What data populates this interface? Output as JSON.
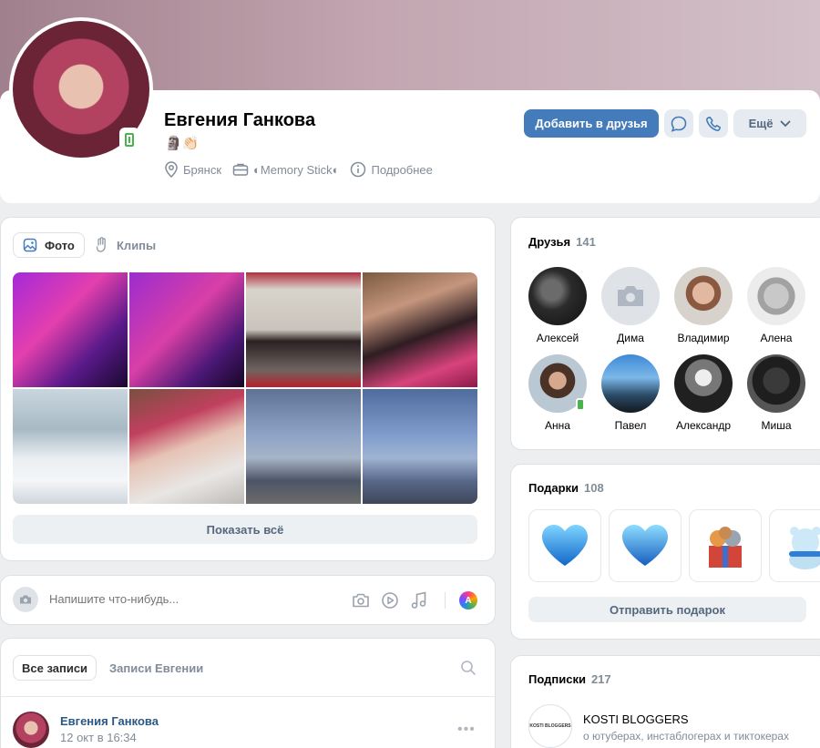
{
  "profile": {
    "name": "Евгения Ганкова",
    "status": "🗿👏🏻",
    "city": "Брянск",
    "work": "◐Memory Stick◐",
    "more_info": "Подробнее",
    "buttons": {
      "add_friend": "Добавить в друзья",
      "more": "Ещё"
    }
  },
  "media": {
    "tabs": [
      {
        "label": "Фото",
        "icon": "image-icon",
        "active": true
      },
      {
        "label": "Клипы",
        "icon": "clips-icon",
        "active": false
      }
    ],
    "show_all": "Показать всё"
  },
  "composer": {
    "placeholder": "Напишите что-нибудь..."
  },
  "wall": {
    "tabs": [
      {
        "label": "Все записи",
        "active": true
      },
      {
        "label": "Записи Евгении",
        "active": false
      }
    ],
    "post": {
      "author": "Евгения Ганкова",
      "time": "12 окт в 16:34"
    }
  },
  "friends": {
    "title": "Друзья",
    "count": "141",
    "items": [
      {
        "name": "Алексей"
      },
      {
        "name": "Дима"
      },
      {
        "name": "Владимир"
      },
      {
        "name": "Алена"
      },
      {
        "name": "Анна"
      },
      {
        "name": "Павел"
      },
      {
        "name": "Александр"
      },
      {
        "name": "Миша"
      }
    ]
  },
  "gifts": {
    "title": "Подарки",
    "count": "108",
    "send": "Отправить подарок"
  },
  "subscriptions": {
    "title": "Подписки",
    "count": "217",
    "items": [
      {
        "name": "KOSTI BLOGGERS",
        "description": "о ютуберах, инстаблогерах и тиктокерах",
        "logo_text": "KOSTI BLOGGERS"
      }
    ]
  },
  "colors": {
    "accent": "#447bba",
    "link": "#2a5885",
    "online": "#4bb34b",
    "secondary_text": "#818c99"
  }
}
